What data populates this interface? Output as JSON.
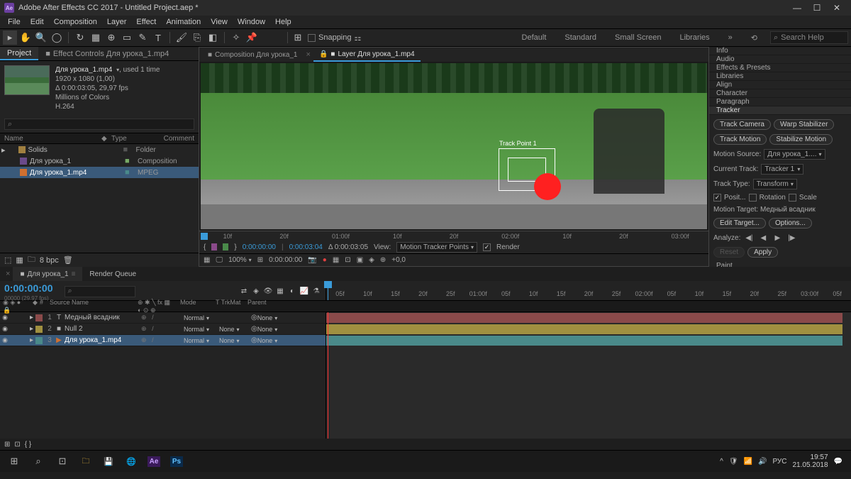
{
  "titlebar": {
    "title": "Adobe After Effects CC 2017 - Untitled Project.aep *",
    "logo": "Ae"
  },
  "menu": [
    "File",
    "Edit",
    "Composition",
    "Layer",
    "Effect",
    "Animation",
    "View",
    "Window",
    "Help"
  ],
  "toolbar": {
    "snapping_label": "Snapping",
    "workspaces": [
      "Default",
      "Standard",
      "Small Screen",
      "Libraries"
    ],
    "search_placeholder": "Search Help"
  },
  "project": {
    "tab_project": "Project",
    "tab_effect_controls": "Effect Controls Для урока_1.mp4",
    "asset": {
      "name": "Для урока_1.mp4",
      "used": ", used 1 time",
      "dims": "1920 x 1080 (1,00)",
      "dur": "Δ 0:00:03:05, 29,97 fps",
      "colors": "Millions of Colors",
      "codec": "H.264"
    },
    "cols": {
      "name": "Name",
      "type": "Type",
      "comment": "Comment"
    },
    "rows": [
      {
        "label": "Solids",
        "type": "Folder",
        "kind": "folder"
      },
      {
        "label": "Для урока_1",
        "type": "Composition",
        "kind": "comp"
      },
      {
        "label": "Для урока_1.mp4",
        "type": "MPEG",
        "kind": "vid",
        "selected": true
      }
    ],
    "bpc": "8 bpc"
  },
  "viewer": {
    "tab_comp": "Composition Для урока_1",
    "tab_layer": "Layer Для урока_1.mp4",
    "track_point": "Track Point 1",
    "ruler_marks": [
      "10f",
      "20f",
      "01:00f",
      "10f",
      "20f",
      "02:00f",
      "10f",
      "20f",
      "03:00f"
    ],
    "ctrl": {
      "tc1": "0:00:00:00",
      "tc2": "0:00:03:04",
      "dur": "Δ 0:00:03:05",
      "view_label": "View:",
      "view_value": "Motion Tracker Points",
      "render": "Render",
      "zoom": "100%",
      "tc3": "0:00:00:00",
      "exp": "+0,0"
    }
  },
  "right": {
    "tabs": [
      "Info",
      "Audio",
      "Effects & Presets",
      "Libraries",
      "Align",
      "Character",
      "Paragraph",
      "Tracker"
    ],
    "tracker": {
      "btn_camera": "Track Camera",
      "btn_warp": "Warp Stabilizer",
      "btn_motion": "Track Motion",
      "btn_stab": "Stabilize Motion",
      "src_label": "Motion Source:",
      "src_value": "Для урока_1....",
      "cur_label": "Current Track:",
      "cur_value": "Tracker 1",
      "type_label": "Track Type:",
      "type_value": "Transform",
      "opt_pos": "Posit...",
      "opt_rot": "Rotation",
      "opt_scale": "Scale",
      "target_label": "Motion Target: Медный всадник",
      "btn_edit": "Edit Target...",
      "btn_opts": "Options...",
      "analyze_label": "Analyze:",
      "btn_reset": "Reset",
      "btn_apply": "Apply"
    },
    "paint": "Paint"
  },
  "timeline": {
    "tab_comp": "Для урока_1",
    "tab_rq": "Render Queue",
    "timecode": "0:00:00:00",
    "sub": "00000 (29.97 fps)",
    "cols": {
      "num": "#",
      "source": "Source Name",
      "mode": "Mode",
      "trk": "T  TrkMat",
      "parent": "Parent"
    },
    "ruler": [
      "05f",
      "10f",
      "15f",
      "20f",
      "25f",
      "01:00f",
      "05f",
      "10f",
      "15f",
      "20f",
      "25f",
      "02:00f",
      "05f",
      "10f",
      "15f",
      "20f",
      "25f",
      "03:00f",
      "05f"
    ],
    "layers": [
      {
        "num": "1",
        "icon": "T",
        "name": "Медный всадник",
        "color": "#8a4a4a",
        "mode": "Normal",
        "trk": "",
        "parent": "None"
      },
      {
        "num": "2",
        "icon": "■",
        "name": "Null 2",
        "color": "#a09040",
        "mode": "Normal",
        "trk": "None",
        "parent": "None"
      },
      {
        "num": "3",
        "icon": "▶",
        "name": "Для урока_1.mp4",
        "color": "#4a8a8a",
        "mode": "Normal",
        "trk": "None",
        "parent": "None",
        "selected": true
      }
    ]
  },
  "taskbar": {
    "lang": "РУС",
    "time": "19:57",
    "date": "21.05.2018"
  }
}
